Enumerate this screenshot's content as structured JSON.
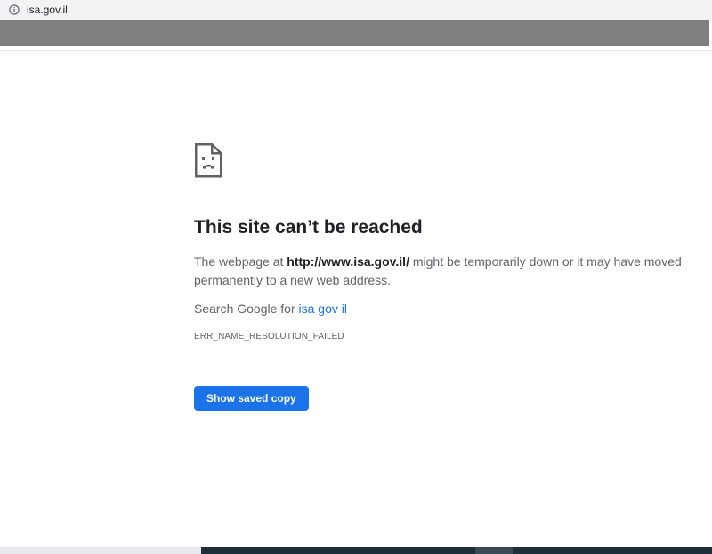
{
  "address_bar": {
    "url": "isa.gov.il",
    "info_icon": "info-icon"
  },
  "error_page": {
    "icon": "sad-page-icon",
    "title": "This site can’t be reached",
    "description_prefix": "The webpage at ",
    "description_url": "http://www.isa.gov.il/",
    "description_suffix": " might be temporarily down or it may have moved permanently to a new web address.",
    "search_prefix": "Search Google for ",
    "search_link": "isa gov il",
    "error_code": "ERR_NAME_RESOLUTION_FAILED",
    "button_label": "Show saved copy"
  },
  "colors": {
    "accent": "#1a73e8",
    "title_text": "#202124",
    "body_text": "#5f6368",
    "bookmarks_bar": "#808080"
  }
}
